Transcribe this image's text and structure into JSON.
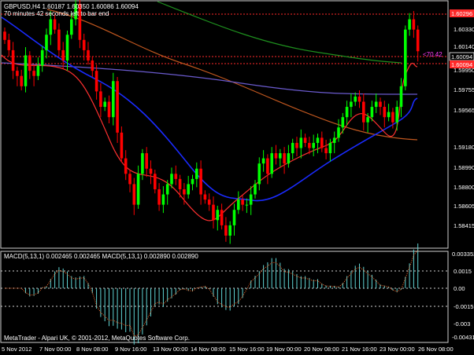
{
  "header": {
    "line1": "GBPUSD,H4  1.60187 1.60350 1.60086 1.60094",
    "line2": "70 minutes 42 seconds left to bar end"
  },
  "ask_marker": "1.60296",
  "bid_marker": "1.60094",
  "mid_label": "1.60094",
  "pips_label": "<70.42",
  "macd_title": "MACD(5,13,1) 0.002465 0.002465  MACD(5,13,1) 0.002890 0.002890",
  "footer": "MetaTrader - Alpari UK, © 2001-2012, MetaQuotes Software Corp.",
  "price_ticks": [
    "1.60330",
    "1.60140",
    "1.59950",
    "1.59755",
    "1.59565",
    "1.59180",
    "1.58990",
    "1.58800",
    "1.58605",
    "1.58415"
  ],
  "macd_ticks": [
    "0.003352",
    "0.0015",
    "0.00",
    "-0.0015",
    "-0.003",
    "-0.00431"
  ],
  "time_ticks": [
    "5 Nov 2012",
    "7 Nov 00:00",
    "8 Nov 08:00",
    "9 Nov 16:00",
    "13 Nov 00:00",
    "14 Nov 08:00",
    "15 Nov 16:00",
    "19 Nov 00:00",
    "20 Nov 08:00",
    "21 Nov 16:00",
    "23 Nov 00:00",
    "26 Nov 08:00"
  ],
  "colors": {
    "bull": "#00ff00",
    "bear": "#ff0000",
    "ma_blue": "#1a2bff",
    "ma_red": "#ff3030",
    "ma_brown": "#c0571f",
    "ma_green": "#1e8f1e",
    "ma_purple": "#6a5acd",
    "macd_hist": "#5fd3d3",
    "macd_signal": "#ff6a2a"
  },
  "chart_data": {
    "type": "candlestick",
    "symbol": "GBPUSD",
    "timeframe": "H4",
    "close": [
      1.602,
      1.601,
      1.599,
      1.5985,
      1.5975,
      1.6005,
      1.599,
      1.5985,
      1.5995,
      1.601,
      1.6025,
      1.604,
      1.603,
      1.601,
      1.6,
      1.6025,
      1.604,
      1.6055,
      1.602,
      1.601,
      1.6,
      1.599,
      1.597,
      1.5955,
      1.596,
      1.5945,
      1.598,
      1.593,
      1.5905,
      1.589,
      1.588,
      1.586,
      1.589,
      1.591,
      1.5895,
      1.589,
      1.5875,
      1.586,
      1.587,
      1.588,
      1.589,
      1.5885,
      1.5875,
      1.587,
      1.588,
      1.5885,
      1.5895,
      1.587,
      1.5865,
      1.586,
      1.5845,
      1.5855,
      1.584,
      1.583,
      1.584,
      1.5855,
      1.5865,
      1.586,
      1.586,
      1.587,
      1.588,
      1.59,
      1.5905,
      1.589,
      1.591,
      1.5905,
      1.591,
      1.59,
      1.591,
      1.592,
      1.5915,
      1.5925,
      1.592,
      1.5915,
      1.592,
      1.5925,
      1.5915,
      1.591,
      1.592,
      1.5925,
      1.5935,
      1.5945,
      1.5955,
      1.596,
      1.5965,
      1.596,
      1.594,
      1.5945,
      1.5955,
      1.596,
      1.5955,
      1.5945,
      1.595,
      1.594,
      1.5955,
      1.5975,
      1.603,
      1.604,
      1.603,
      1.6009
    ]
  }
}
